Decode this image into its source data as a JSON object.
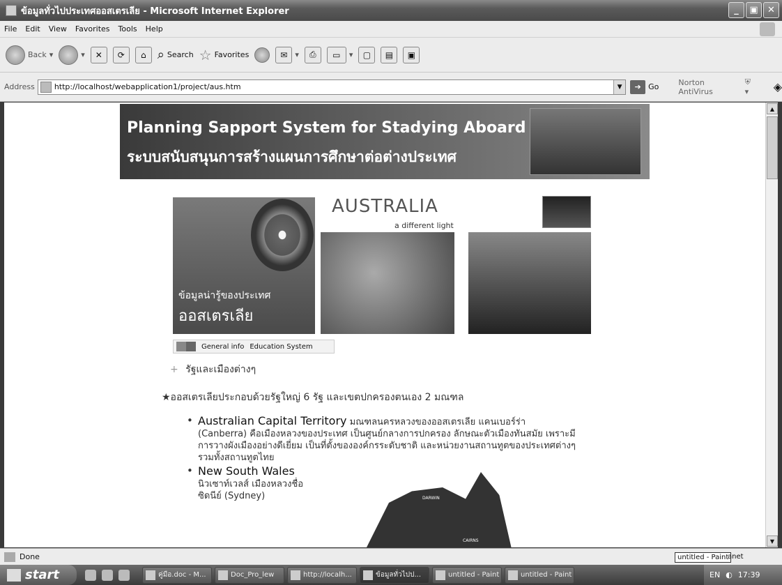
{
  "window": {
    "title": "ข้อมูลทั่วไปประเทศออสเตรเลีย - Microsoft Internet Explorer",
    "minimize": "_",
    "maximize": "▣",
    "close": "✕"
  },
  "menu": [
    "File",
    "Edit",
    "View",
    "Favorites",
    "Tools",
    "Help"
  ],
  "toolbar": {
    "back": "Back",
    "search": "Search",
    "favorites": "Favorites"
  },
  "address": {
    "label": "Address",
    "url": "http://localhost/webapplication1/project/aus.htm",
    "go": "Go",
    "norton": "Norton AntiVirus"
  },
  "page": {
    "banner_en": "Planning Sapport System for Stadying Aboard",
    "banner_th": "ระบบสนับสนุนการสร้างแผนการศึกษาต่อต่างประเทศ",
    "aus_title": "AUSTRALIA",
    "aus_subtitle": "a different light",
    "left_t1": "ข้อมูลน่ารู้ของประเทศ",
    "left_t2": "ออสเตรเลีย",
    "info_links": [
      "General info",
      "Education System"
    ],
    "section_heading": "รัฐและเมืองต่างๆ",
    "intro": "★ออสเตรเลียประกอบด้วยรัฐใหญ่ 6 รัฐ และเขตปกครองตนเอง 2 มณฑล",
    "items": [
      {
        "name": "Australian Capital Territory",
        "text": " มณฑลนครหลวงของออสเตรเลีย แคนเบอร์ร่า (Canberra) คือเมืองหลวงของประเทศ เป็นศูนย์กลางการปกครอง ลักษณะตัวเมืองทันสมัย เพราะมีการวางผังเมืองอย่างดีเยี่ยม เป็นที่ตั้งขององค์กรระดับชาติ และหน่วยงานสถานทูตของประเทศต่างๆ รวมทั้งสถานทูตไทย"
      },
      {
        "name": "New South Wales",
        "text": " นิวเซาท์เวลส์ เมืองหลวงชื่อซิดนีย์ (Sydney)"
      }
    ],
    "map_labels": [
      "DARWIN",
      "CAIRNS"
    ]
  },
  "status": {
    "text": "Done",
    "tooltip": "untitled - Paint",
    "tooltip_tail": "anet"
  },
  "taskbar": {
    "start": "start",
    "tasks": [
      "คู่มือ.doc - M...",
      "Doc_Pro_lew",
      "http://localh...",
      "ข้อมูลทั่วไปป...",
      "untitled - Paint",
      "untitled - Paint"
    ],
    "lang": "EN",
    "time": "17:39"
  }
}
